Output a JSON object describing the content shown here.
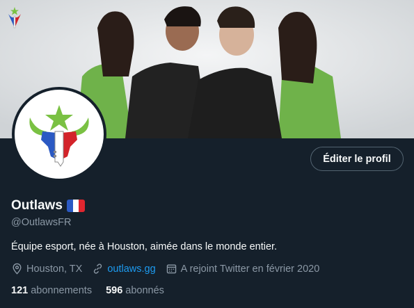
{
  "profile": {
    "display_name": "Outlaws",
    "flag": "🇫🇷",
    "handle": "@OutlawsFR",
    "bio": "Équipe esport, née à Houston, aimée dans le monde entier.",
    "edit_button": "Éditer le profil"
  },
  "meta": {
    "location": "Houston, TX",
    "location_icon": "location-pin-icon",
    "website": "outlaws.gg",
    "website_icon": "link-icon",
    "joined": "A rejoint Twitter en février 2020",
    "joined_icon": "calendar-icon"
  },
  "stats": {
    "following_count": "121",
    "following_label": "abonnements",
    "followers_count": "596",
    "followers_label": "abonnés"
  },
  "colors": {
    "background": "#15202b",
    "accent_link": "#1d9bf0",
    "secondary_text": "#8b98a5",
    "logo_green": "#7ac143",
    "logo_blue": "#2b59c3",
    "logo_red": "#d3232a"
  }
}
